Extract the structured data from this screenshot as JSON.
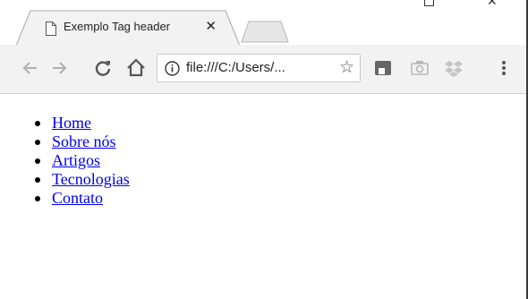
{
  "browser": {
    "tab_title": "Exemplo Tag header",
    "tab_close_glyph": "✕",
    "url": "file:///C:/Users/...",
    "icons": [
      "back-icon",
      "forward-icon",
      "reload-icon",
      "home-icon",
      "info-icon",
      "bookmark-star-icon",
      "extension-icon",
      "camera-icon",
      "dropbox-icon",
      "menu-icon"
    ],
    "star_glyph": "☆"
  },
  "nav": {
    "items": [
      {
        "label": "Home"
      },
      {
        "label": "Sobre nós"
      },
      {
        "label": "Artigos"
      },
      {
        "label": "Tecnologias"
      },
      {
        "label": "Contato"
      }
    ]
  },
  "colors": {
    "link": "#0000ee",
    "toolbar_bg": "#f2f2f2"
  }
}
